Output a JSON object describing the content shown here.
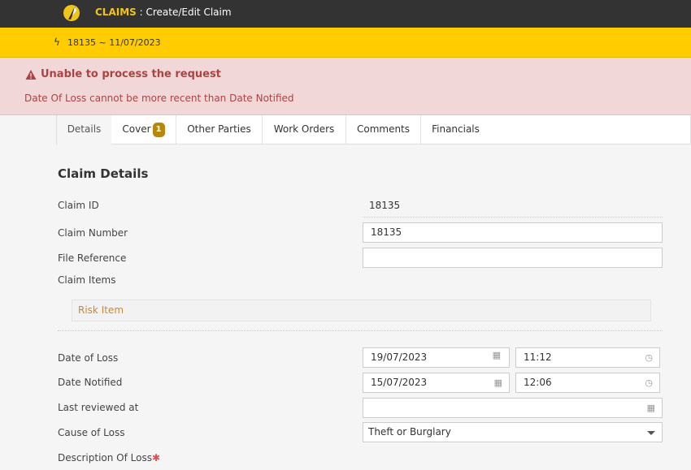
{
  "header": {
    "app_name": "CLAIMS",
    "page_title": " : Create/Edit Claim",
    "logo_icon": "quill-logo-icon"
  },
  "context_bar": {
    "icon": "bolt-icon",
    "label": "18135 ~ 11/07/2023"
  },
  "alert": {
    "icon": "warning-icon",
    "title": "Unable to process the request",
    "message": "Date Of Loss cannot be more recent than Date Notified"
  },
  "tabs": [
    {
      "label": "Details",
      "active": true
    },
    {
      "label": "Cover",
      "badge": "1"
    },
    {
      "label": "Other Parties"
    },
    {
      "label": "Work Orders"
    },
    {
      "label": "Comments"
    },
    {
      "label": "Financials"
    }
  ],
  "section": {
    "title": "Claim Details"
  },
  "fields": {
    "claim_id": {
      "label": "Claim ID",
      "value": "18135"
    },
    "claim_number": {
      "label": "Claim Number",
      "value": "18135"
    },
    "file_reference": {
      "label": "File Reference",
      "value": ""
    },
    "claim_items": {
      "label": "Claim Items",
      "item": "Risk Item"
    },
    "date_of_loss": {
      "label": "Date of Loss",
      "date": "19/07/2023",
      "time": "11:12"
    },
    "date_notified": {
      "label": "Date Notified",
      "date": "15/07/2023",
      "time": "12:06"
    },
    "last_reviewed": {
      "label": "Last reviewed at",
      "date": ""
    },
    "cause_of_loss": {
      "label": "Cause of Loss",
      "value": "Theft or Burglary"
    },
    "description_of_loss": {
      "label": "Description Of Loss",
      "required_mark": "✱"
    }
  },
  "icons": {
    "calendar": "calendar-icon",
    "clock": "clock-icon",
    "dropdown": "chevron-down-icon"
  },
  "colors": {
    "topbar": "#333333",
    "context_bar": "#ffcc00",
    "alert_bg": "#f2d7d9",
    "alert_text": "#a94442",
    "badge": "#b8860b",
    "risk_item": "#c8873a"
  }
}
